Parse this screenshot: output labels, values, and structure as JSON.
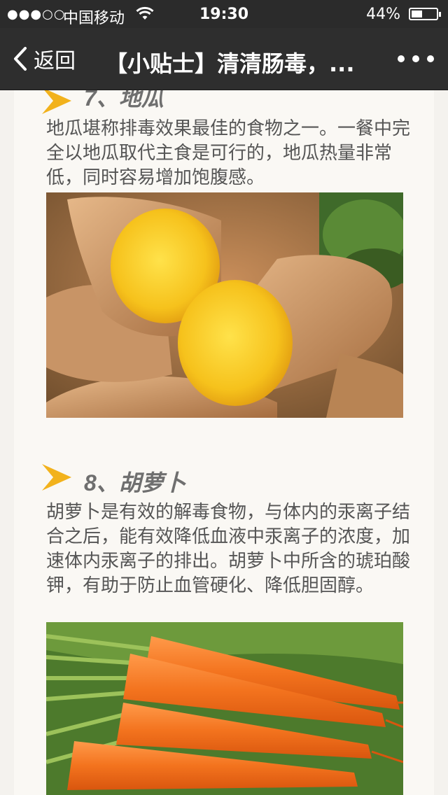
{
  "status_bar": {
    "signal": "●●●○○",
    "carrier": "中国移动",
    "time": "19:30",
    "battery": "44%",
    "battery_level": 0.44
  },
  "nav": {
    "back_label": "返回",
    "title": "【小贴士】清清肠毒，..."
  },
  "sections": [
    {
      "heading": "7、地瓜",
      "body": "地瓜堪称排毒效果最佳的食物之一。一餐中完全以地瓜取代主食是可行的，地瓜热量非常低，同时容易增加饱腹感。",
      "image": "sweet-potato-photo"
    },
    {
      "heading": "8、胡萝卜",
      "body": "胡萝卜是有效的解毒食物，与体内的汞离子结合之后，能有效降低血液中汞离子的浓度，加速体内汞离子的排出。胡萝卜中所含的琥珀酸钾，有助于防止血管硬化、降低胆固醇。",
      "image": "carrot-photo"
    }
  ],
  "colors": {
    "chevron": "#f2b21c",
    "nav_bg": "#2e2e2e",
    "status_bg": "#2b2b2b"
  }
}
